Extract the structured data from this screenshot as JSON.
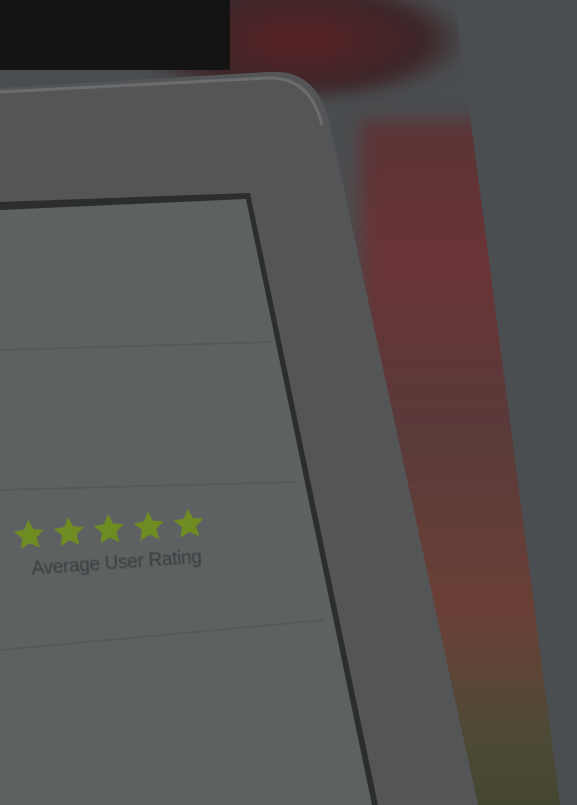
{
  "rating": {
    "label": "Average User Rating",
    "stars_filled": 5,
    "stars_total": 5,
    "star_color": "#6e8c22"
  },
  "colors": {
    "background": "#4a4d50",
    "screen": "#5d6061",
    "bezel": "#595b5d"
  }
}
